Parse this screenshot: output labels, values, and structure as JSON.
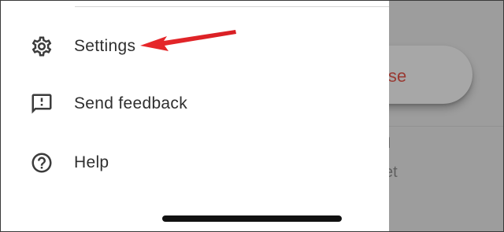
{
  "menu": {
    "items": [
      {
        "label": "Settings",
        "icon": "gear-icon"
      },
      {
        "label": "Send feedback",
        "icon": "feedback-icon"
      },
      {
        "label": "Help",
        "icon": "help-icon"
      }
    ]
  },
  "background": {
    "compose_label": "ompose",
    "fragment_1": "l",
    "fragment_2": "et"
  },
  "annotation": {
    "arrow_color": "#e8282b",
    "points_to": "Settings"
  },
  "colors": {
    "compose_text": "#993a33",
    "drawer_text": "#2f2f2f",
    "scrim": "#9c9c9c"
  }
}
